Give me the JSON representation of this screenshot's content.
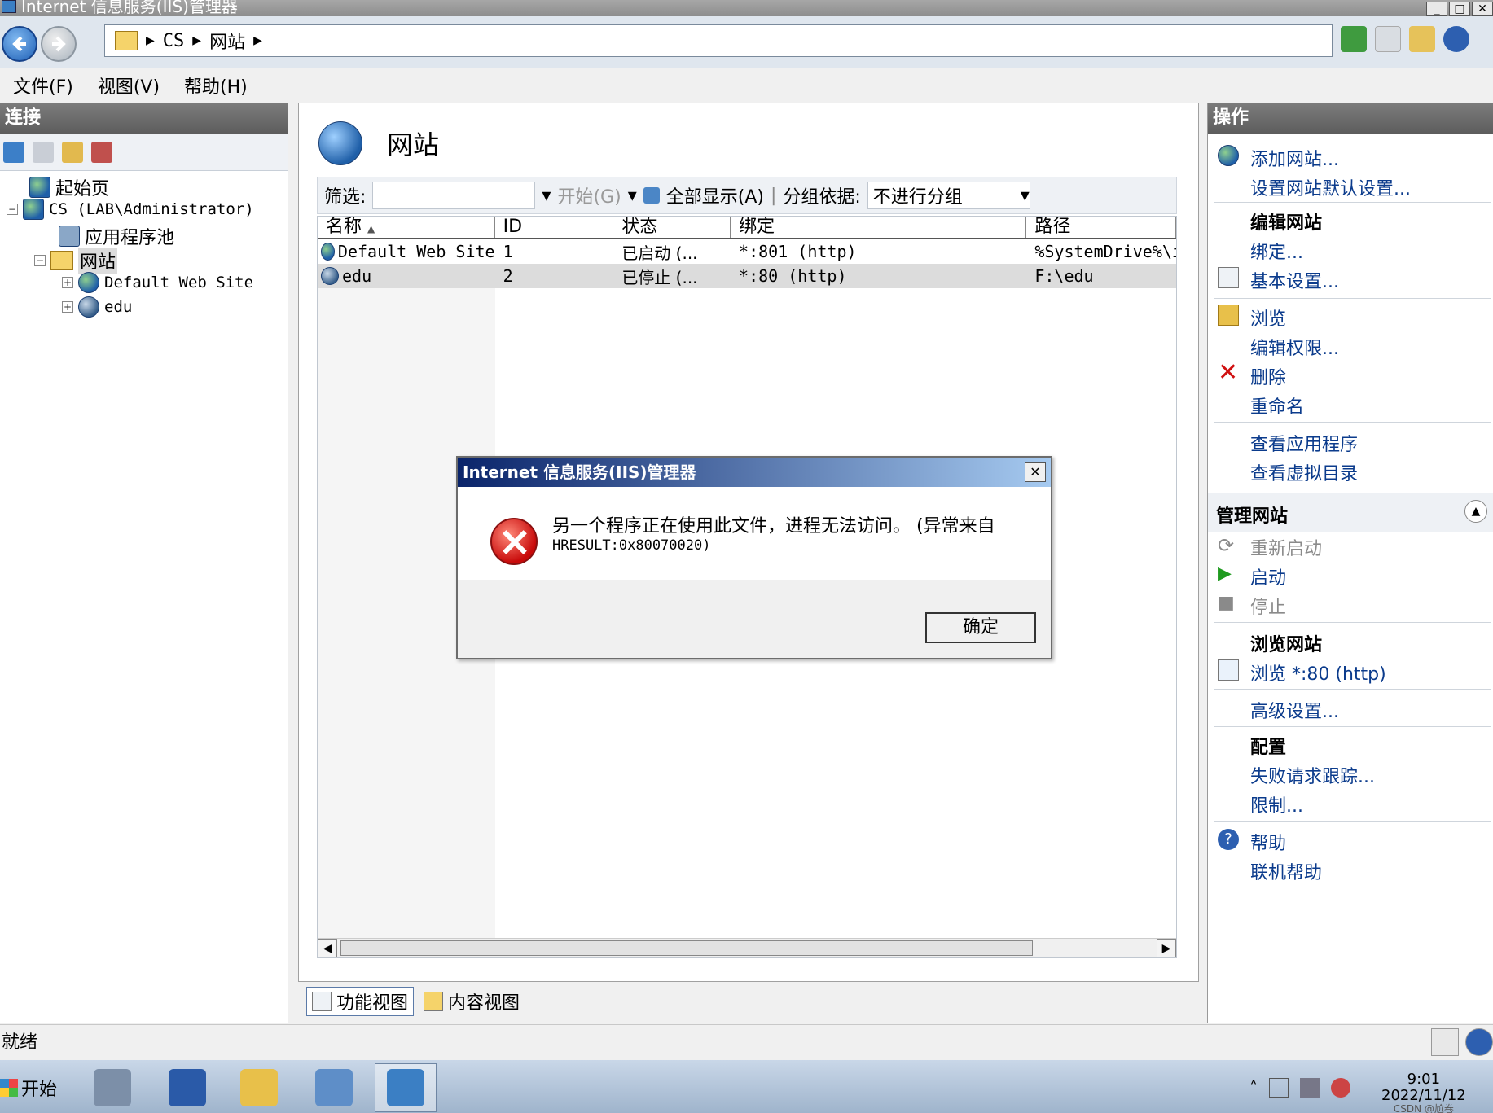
{
  "window": {
    "title": "Internet 信息服务(IIS)管理器"
  },
  "address": {
    "crumbs": [
      "CS",
      "网站"
    ]
  },
  "menu": {
    "file": "文件(F)",
    "view": "视图(V)",
    "help": "帮助(H)"
  },
  "connections": {
    "header": "连接",
    "tree": {
      "start_page": "起始页",
      "server": "CS (LAB\\Administrator)",
      "app_pools": "应用程序池",
      "sites": "网站",
      "site1": "Default Web Site",
      "site2": "edu"
    }
  },
  "center": {
    "title": "网站",
    "filter": {
      "label": "筛选:",
      "value": "",
      "go": "开始(G)",
      "show_all": "全部显示(A)",
      "group_by_label": "分组依据:",
      "group_by_value": "不进行分组"
    },
    "columns": [
      "名称",
      "ID",
      "状态",
      "绑定",
      "路径"
    ],
    "rows": [
      {
        "name": "Default Web Site",
        "id": "1",
        "status": "已启动 (...",
        "binding": "*:801 (http)",
        "path": "%SystemDrive%\\in"
      },
      {
        "name": "edu",
        "id": "2",
        "status": "已停止 (...",
        "binding": "*:80 (http)",
        "path": "F:\\edu"
      }
    ],
    "view_tabs": {
      "features": "功能视图",
      "content": "内容视图"
    }
  },
  "actions": {
    "header": "操作",
    "add_site": "添加网站...",
    "set_defaults": "设置网站默认设置...",
    "edit_site_head": "编辑网站",
    "bindings": "绑定...",
    "basic_settings": "基本设置...",
    "explore": "浏览",
    "edit_permissions": "编辑权限...",
    "delete": "删除",
    "rename": "重命名",
    "view_apps": "查看应用程序",
    "view_vdirs": "查看虚拟目录",
    "manage_head": "管理网站",
    "restart": "重新启动",
    "start": "启动",
    "stop": "停止",
    "browse_head": "浏览网站",
    "browse_80": "浏览 *:80 (http)",
    "advanced": "高级设置...",
    "config_head": "配置",
    "failed_trace": "失败请求跟踪...",
    "limits": "限制...",
    "help": "帮助",
    "online_help": "联机帮助"
  },
  "status": {
    "text": "就绪"
  },
  "taskbar": {
    "start": "开始",
    "time": "9:01",
    "date": "2022/11/12",
    "watermark": "CSDN @尬卷"
  },
  "dialog": {
    "title": "Internet 信息服务(IIS)管理器",
    "message_line1": "另一个程序正在使用此文件，进程无法访问。 (异常来自",
    "message_line2": "HRESULT:0x80070020)",
    "ok": "确定"
  },
  "colors": {
    "accent": "#0b3b8c",
    "dialog_title": "#0a246a",
    "error": "#c80a0a"
  }
}
